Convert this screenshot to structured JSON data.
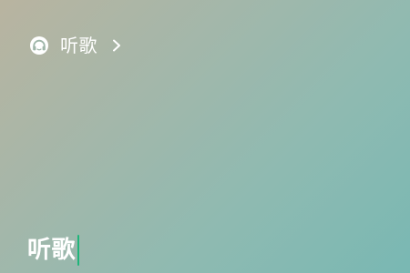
{
  "header": {
    "title": "听歌",
    "icon": "headphones-icon",
    "chevron_icon": "chevron-right-icon"
  },
  "input": {
    "value": "听歌",
    "caret_color": "#1fb57a"
  },
  "colors": {
    "bg_start": "#b9b4a0",
    "bg_end": "#79b8b3",
    "text": "#ffffff"
  }
}
